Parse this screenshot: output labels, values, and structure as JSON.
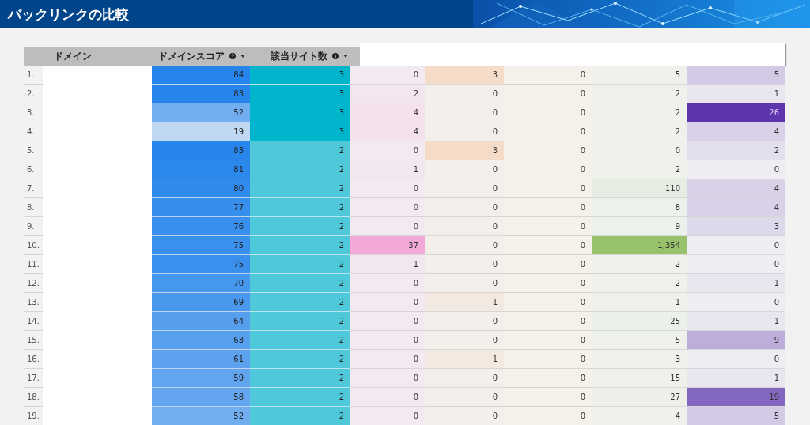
{
  "header": {
    "title": "バックリンクの比較"
  },
  "table": {
    "columns": [
      {
        "label": "ドメイン",
        "kind": "plain"
      },
      {
        "label": "ドメインスコア",
        "kind": "sortable_help"
      },
      {
        "label": "該当サイト数",
        "kind": "sortable_info"
      }
    ],
    "rows": [
      {
        "number": "1.",
        "score": "84",
        "sites": "3",
        "values": [
          "0",
          "3",
          "0",
          "5",
          "5"
        ]
      },
      {
        "number": "2.",
        "score": "83",
        "sites": "3",
        "values": [
          "2",
          "0",
          "0",
          "2",
          "1"
        ]
      },
      {
        "number": "3.",
        "score": "52",
        "sites": "3",
        "values": [
          "4",
          "0",
          "0",
          "2",
          "26"
        ]
      },
      {
        "number": "4.",
        "score": "19",
        "sites": "3",
        "values": [
          "4",
          "0",
          "0",
          "2",
          "4"
        ]
      },
      {
        "number": "5.",
        "score": "83",
        "sites": "2",
        "values": [
          "0",
          "3",
          "0",
          "0",
          "2"
        ]
      },
      {
        "number": "6.",
        "score": "81",
        "sites": "2",
        "values": [
          "1",
          "0",
          "0",
          "2",
          "0"
        ]
      },
      {
        "number": "7.",
        "score": "80",
        "sites": "2",
        "values": [
          "0",
          "0",
          "0",
          "110",
          "4"
        ]
      },
      {
        "number": "8.",
        "score": "77",
        "sites": "2",
        "values": [
          "0",
          "0",
          "0",
          "8",
          "4"
        ]
      },
      {
        "number": "9.",
        "score": "76",
        "sites": "2",
        "values": [
          "0",
          "0",
          "0",
          "9",
          "3"
        ]
      },
      {
        "number": "10.",
        "score": "75",
        "sites": "2",
        "values": [
          "37",
          "0",
          "0",
          "1,354",
          "0"
        ]
      },
      {
        "number": "11.",
        "score": "75",
        "sites": "2",
        "values": [
          "1",
          "0",
          "0",
          "2",
          "0"
        ]
      },
      {
        "number": "12.",
        "score": "70",
        "sites": "2",
        "values": [
          "0",
          "0",
          "0",
          "2",
          "1"
        ]
      },
      {
        "number": "13.",
        "score": "69",
        "sites": "2",
        "values": [
          "0",
          "1",
          "0",
          "1",
          "0"
        ]
      },
      {
        "number": "14.",
        "score": "64",
        "sites": "2",
        "values": [
          "0",
          "0",
          "0",
          "25",
          "1"
        ]
      },
      {
        "number": "15.",
        "score": "63",
        "sites": "2",
        "values": [
          "0",
          "0",
          "0",
          "5",
          "9"
        ]
      },
      {
        "number": "16.",
        "score": "61",
        "sites": "2",
        "values": [
          "0",
          "1",
          "0",
          "3",
          "0"
        ]
      },
      {
        "number": "17.",
        "score": "59",
        "sites": "2",
        "values": [
          "0",
          "0",
          "0",
          "15",
          "1"
        ]
      },
      {
        "number": "18.",
        "score": "58",
        "sites": "2",
        "values": [
          "0",
          "0",
          "0",
          "27",
          "19"
        ]
      },
      {
        "number": "19.",
        "score": "52",
        "sites": "2",
        "values": [
          "0",
          "0",
          "0",
          "4",
          "5"
        ]
      }
    ]
  }
}
